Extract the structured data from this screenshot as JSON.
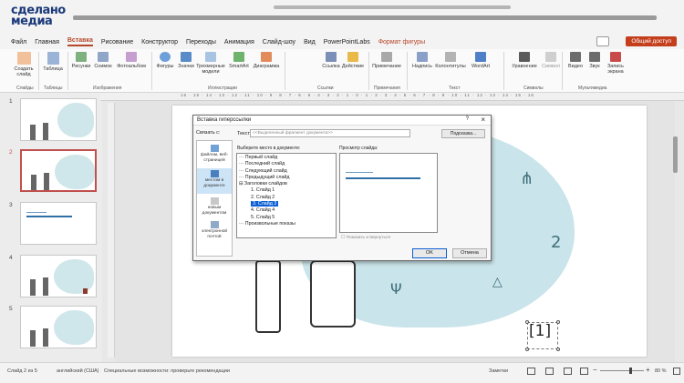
{
  "logo": {
    "line1": "сделано",
    "line2": "медиа"
  },
  "menu": {
    "items": [
      "Файл",
      "Главная",
      "Вставка",
      "Рисование",
      "Конструктор",
      "Переходы",
      "Анимация",
      "Слайд-шоу",
      "Вид",
      "PowerPointLabs",
      "Формат фигуры"
    ],
    "active": "Вставка",
    "share_label": "Общий доступ"
  },
  "ribbon": {
    "buttons": [
      "Создать слайд",
      "Таблица",
      "Рисунки",
      "Снимок",
      "Фотоальбом",
      "Фигуры",
      "Значки",
      "Трехмерные модели",
      "SmartArt",
      "Диаграмма",
      "Ссылка",
      "Действие",
      "Примечание",
      "Надпись",
      "Колонтитулы",
      "WordArt",
      "Уравнение",
      "Символ",
      "Видео",
      "Звук",
      "Запись экрана"
    ],
    "groups": [
      "Слайды",
      "Таблицы",
      "Изображения",
      "Иллюстрации",
      "Ссылки",
      "Примечания",
      "Текст",
      "Символы",
      "Мультимедиа"
    ]
  },
  "ruler": {
    "marks": "16 · 15 · 14 · 13 · 12 · 11 · 10 · 9 · 8 · 7 · 6 · 5 · 4 · 3 · 2 · 1 · 0 · 1 · 2 · 3 · 4 · 5 · 6 · 7 · 8 · 9 · 10 · 11 · 12 · 13 · 14 · 15 · 16"
  },
  "slides": {
    "numbers": [
      "1",
      "2",
      "3",
      "4",
      "5"
    ],
    "selected": "2"
  },
  "dialog": {
    "title": "Вставка гиперссылки",
    "help": "?",
    "close": "×",
    "link_label": "Связать с:",
    "link_options": [
      "файлом, веб-страницей",
      "местом в документе",
      "новым документом",
      "электронной почтой"
    ],
    "text_label": "Текст:",
    "text_value": "<<Выделенный фрагмент документа>>",
    "hint_button": "Подсказка...",
    "place_label": "Выберите место в документе:",
    "tree": {
      "items": [
        "Первый слайд",
        "Последний слайд",
        "Следующий слайд",
        "Предыдущий слайд"
      ],
      "group": "Заголовки слайдов",
      "slides": [
        "1. Слайд 1",
        "2. Слайд 2",
        "3. Слайд 3",
        "4. Слайд 4",
        "5. Слайд 5"
      ],
      "selected": "3. Слайд 3",
      "custom": "Произвольные показы"
    },
    "preview_label": "Просмотр слайда:",
    "return_checkbox": "Показать и вернуться",
    "ok": "OK",
    "cancel": "Отмена"
  },
  "slide": {
    "bracket_text": "[1]"
  },
  "status": {
    "slide_counter": "Слайд 2 из 5",
    "language": "английский (США)",
    "accessibility": "Специальные возможности: проверьте рекомендации",
    "notes": "Заметки",
    "zoom": "80 %"
  },
  "colors": {
    "accent": "#b7472a",
    "share": "#c43e1c",
    "blob": "#c9e4ea",
    "selection": "#0b5fd6"
  }
}
